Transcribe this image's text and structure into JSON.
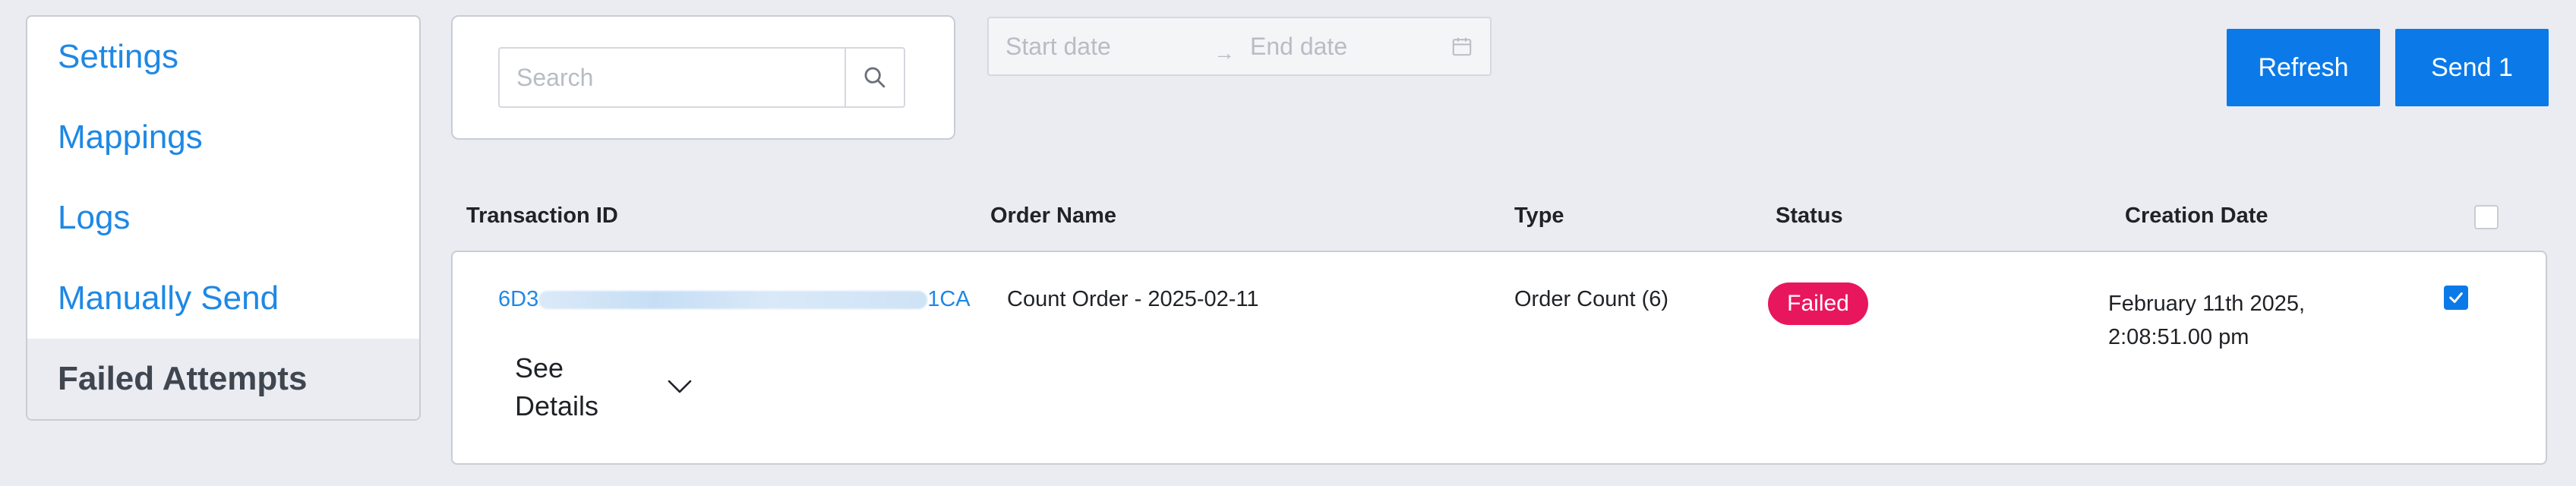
{
  "sidebar": {
    "items": [
      {
        "label": "Settings"
      },
      {
        "label": "Mappings"
      },
      {
        "label": "Logs"
      },
      {
        "label": "Manually Send"
      },
      {
        "label": "Failed Attempts",
        "active": true
      }
    ]
  },
  "search": {
    "placeholder": "Search",
    "icon": "search-icon"
  },
  "date_range": {
    "start_placeholder": "Start date",
    "separator": "→",
    "end_placeholder": "End date",
    "icon": "calendar-icon"
  },
  "toolbar": {
    "refresh_label": "Refresh",
    "send_label": "Send 1"
  },
  "table": {
    "headers": {
      "transaction_id": "Transaction ID",
      "order_name": "Order Name",
      "type": "Type",
      "status": "Status",
      "creation_date": "Creation Date"
    },
    "rows": [
      {
        "transaction_id_prefix": "6D3",
        "transaction_id_suffix": "1CA",
        "order_name": "Count Order - 2025-02-11",
        "type": "Order Count (6)",
        "status": "Failed",
        "creation_date_line1": "February 11th 2025,",
        "creation_date_line2": "2:08:51.00 pm",
        "checked": true,
        "details_label": "See Details"
      }
    ]
  },
  "colors": {
    "accent": "#0b7ae8",
    "link": "#1e88e5",
    "failed": "#e8175d",
    "background": "#eaecf2"
  }
}
